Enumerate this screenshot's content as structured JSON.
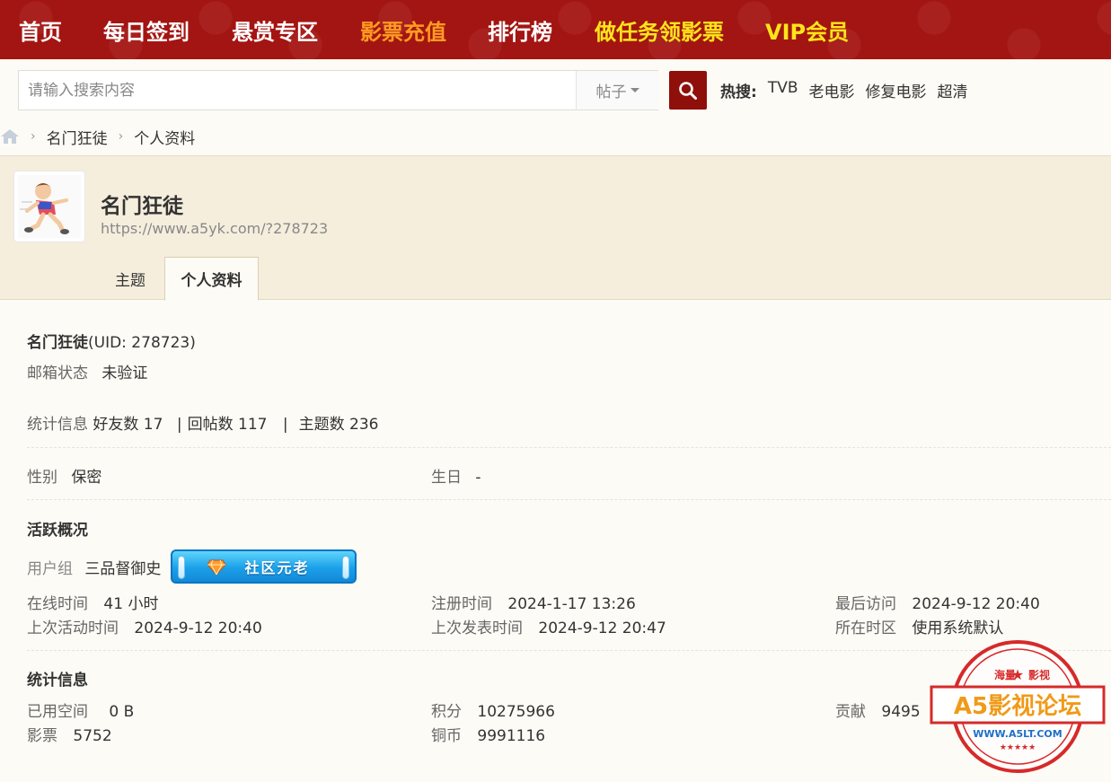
{
  "nav": {
    "items": [
      {
        "label": "首页",
        "style": "white"
      },
      {
        "label": "每日签到",
        "style": "white"
      },
      {
        "label": "悬赏专区",
        "style": "white"
      },
      {
        "label": "影票充值",
        "style": "orange"
      },
      {
        "label": "排行榜",
        "style": "white"
      },
      {
        "label": "做任务领影票",
        "style": "yellow"
      },
      {
        "label": "VIP会员",
        "style": "yellow"
      }
    ],
    "bg_color": "#a31512"
  },
  "search": {
    "placeholder": "请输入搜索内容",
    "type": "帖子",
    "button_icon": "search-icon",
    "hot_label": "热搜:",
    "hot_terms": [
      "TVB",
      "老电影",
      "修复电影",
      "超清"
    ]
  },
  "breadcrumb": {
    "home_icon": "home-icon",
    "items": [
      "名门狂徒",
      "个人资料"
    ]
  },
  "profile": {
    "name": "名门狂徒",
    "url": "https://www.a5yk.com/?278723",
    "tabs": [
      "主题",
      "个人资料"
    ],
    "active_tab": "个人资料"
  },
  "info": {
    "name_uid": "名门狂徒",
    "uid": "(UID: 278723)",
    "email_label": "邮箱状态",
    "email_value": "未验证",
    "stats_label": "统计信息",
    "friends": "好友数 17",
    "sep1": "|",
    "replies": "回帖数 117",
    "sep2": "|",
    "topics": "主题数 236",
    "gender_label": "性别",
    "gender_value": "保密",
    "birthday_label": "生日",
    "birthday_value": "-"
  },
  "activity": {
    "title": "活跃概况",
    "group_label": "用户组",
    "group_value": "三品督御史",
    "badge_text": "社区元老",
    "online_label": "在线时间",
    "online_value": "41 小时",
    "reg_label": "注册时间",
    "reg_value": "2024-1-17 13:26",
    "last_visit_label": "最后访问",
    "last_visit_value": "2024-9-12 20:40",
    "last_active_label": "上次活动时间",
    "last_active_value": "2024-9-12 20:40",
    "last_post_label": "上次发表时间",
    "last_post_value": "2024-9-12 20:47",
    "tz_label": "所在时区",
    "tz_value": "使用系统默认"
  },
  "stats": {
    "title": "统计信息",
    "space_label": "已用空间",
    "space_value": "0 B",
    "points_label": "积分",
    "points_value": "10275966",
    "contrib_label": "贡献",
    "contrib_value": "9495",
    "tickets_label": "影票",
    "tickets_value": "5752",
    "coins_label": "铜币",
    "coins_value": "9991116"
  },
  "stamp": {
    "top_left": "海量",
    "top_right": "影视",
    "main": "A5影视论坛",
    "url": "WWW.A5LT.COM",
    "color": "#d62a2a"
  }
}
